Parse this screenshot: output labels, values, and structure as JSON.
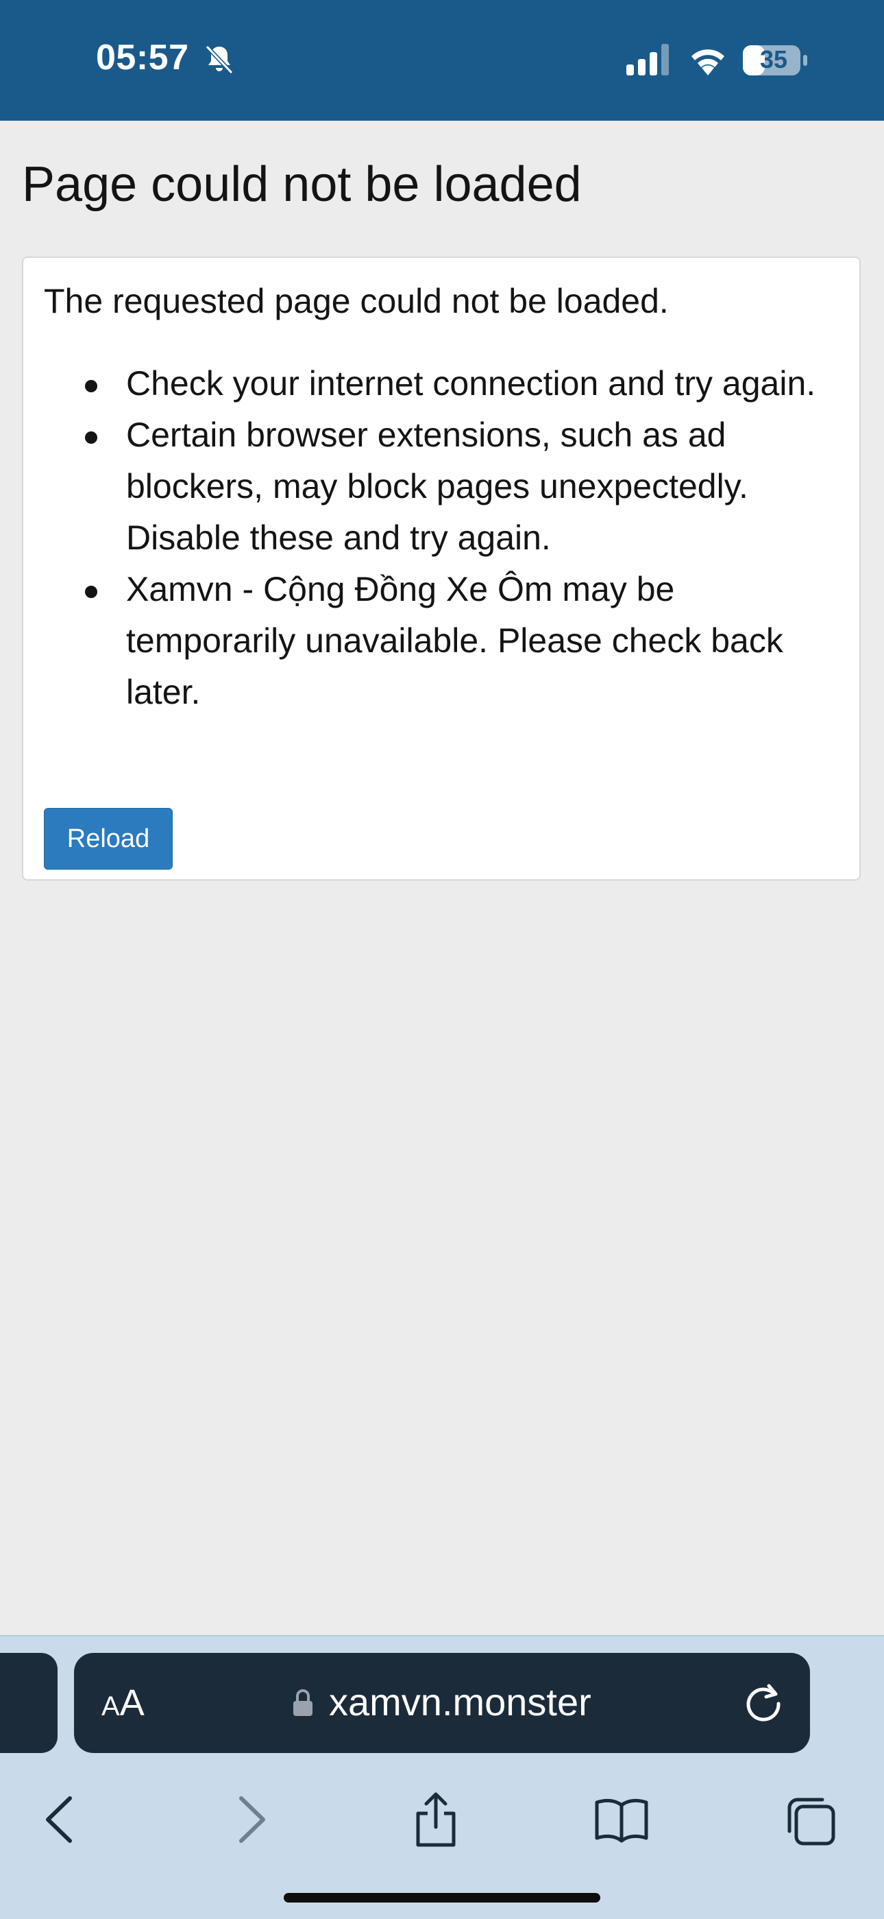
{
  "status_bar": {
    "time": "05:57",
    "battery_level": "35",
    "icons": [
      "bell-slash-icon",
      "cellular-signal-icon",
      "wifi-icon",
      "battery-icon"
    ],
    "background_color": "#1a5a8a"
  },
  "page": {
    "title": "Page could not be loaded",
    "intro": "The requested page could not be loaded.",
    "reasons": [
      "Check your internet connection and try again.",
      "Certain browser extensions, such as ad blockers, may block pages unexpectedly. Disable these and try again.",
      "Xamvn - Cộng Đồng Xe Ôm may be temporarily unavailable. Please check back later."
    ],
    "reload_label": "Reload",
    "button_color": "#2c7bbf"
  },
  "browser": {
    "text_size_label_small": "A",
    "text_size_label_large": "A",
    "url": "xamvn.monster",
    "icons": [
      "lock-icon",
      "reload-page-icon",
      "back-icon",
      "forward-icon",
      "share-icon",
      "bookmarks-icon",
      "tabs-icon"
    ]
  }
}
